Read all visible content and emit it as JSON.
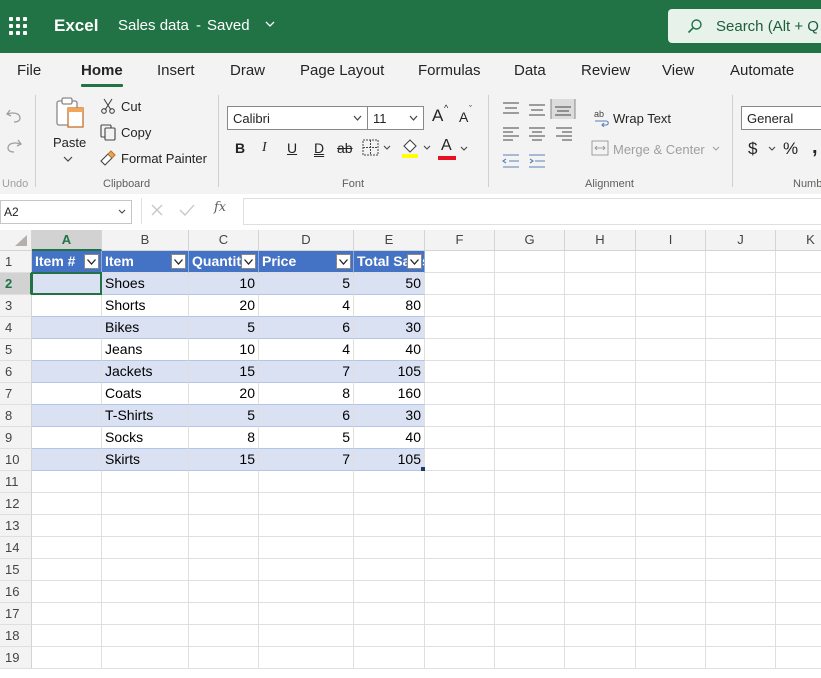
{
  "app": {
    "name": "Excel",
    "doc_name": "Sales data",
    "separator": "-",
    "status": "Saved"
  },
  "search": {
    "text": "Search (Alt + Q"
  },
  "tabs": [
    {
      "label": "File",
      "active": false
    },
    {
      "label": "Home",
      "active": true
    },
    {
      "label": "Insert",
      "active": false
    },
    {
      "label": "Draw",
      "active": false
    },
    {
      "label": "Page Layout",
      "active": false
    },
    {
      "label": "Formulas",
      "active": false
    },
    {
      "label": "Data",
      "active": false
    },
    {
      "label": "Review",
      "active": false
    },
    {
      "label": "View",
      "active": false
    },
    {
      "label": "Automate",
      "active": false
    }
  ],
  "ribbon": {
    "undo_group": "Undo",
    "clipboard": {
      "paste": "Paste",
      "cut": "Cut",
      "copy": "Copy",
      "format_painter": "Format Painter",
      "group": "Clipboard"
    },
    "font": {
      "name": "Calibri",
      "size": "11",
      "group": "Font",
      "bold": "B",
      "italic": "I",
      "underline": "U",
      "double_underline": "D",
      "strike": "ab",
      "grow": "A",
      "shrink": "A",
      "font_color": "A"
    },
    "alignment": {
      "wrap_text": "Wrap Text",
      "merge_center": "Merge & Center",
      "group": "Alignment"
    },
    "number": {
      "format": "General",
      "currency": "$",
      "percent": "%",
      "group": "Numb"
    }
  },
  "formula_bar": {
    "name_box": "A2",
    "fx": "fx",
    "value": ""
  },
  "sheet": {
    "columns": [
      "A",
      "B",
      "C",
      "D",
      "E",
      "F",
      "G",
      "H",
      "I",
      "J",
      "K"
    ],
    "rows": [
      "1",
      "2",
      "3",
      "4",
      "5",
      "6",
      "7",
      "8",
      "9",
      "10",
      "11",
      "12",
      "13",
      "14",
      "15",
      "16",
      "17",
      "18",
      "19"
    ],
    "selected_cell": "A2",
    "table_headers": [
      "Item #",
      "Item",
      "Quantity",
      "Price",
      "Total Sales"
    ],
    "table_rows": [
      {
        "item_no": "",
        "item": "Shoes",
        "quantity": "10",
        "price": "5",
        "total": "50"
      },
      {
        "item_no": "",
        "item": "Shorts",
        "quantity": "20",
        "price": "4",
        "total": "80"
      },
      {
        "item_no": "",
        "item": "Bikes",
        "quantity": "5",
        "price": "6",
        "total": "30"
      },
      {
        "item_no": "",
        "item": "Jeans",
        "quantity": "10",
        "price": "4",
        "total": "40"
      },
      {
        "item_no": "",
        "item": "Jackets",
        "quantity": "15",
        "price": "7",
        "total": "105"
      },
      {
        "item_no": "",
        "item": "Coats",
        "quantity": "20",
        "price": "8",
        "total": "160"
      },
      {
        "item_no": "",
        "item": "T-Shirts",
        "quantity": "5",
        "price": "6",
        "total": "30"
      },
      {
        "item_no": "",
        "item": "Socks",
        "quantity": "8",
        "price": "5",
        "total": "40"
      },
      {
        "item_no": "",
        "item": "Skirts",
        "quantity": "15",
        "price": "7",
        "total": "105"
      }
    ]
  },
  "colors": {
    "brand": "#217346",
    "table_header": "#4472c4",
    "table_band": "#d9e1f2"
  }
}
